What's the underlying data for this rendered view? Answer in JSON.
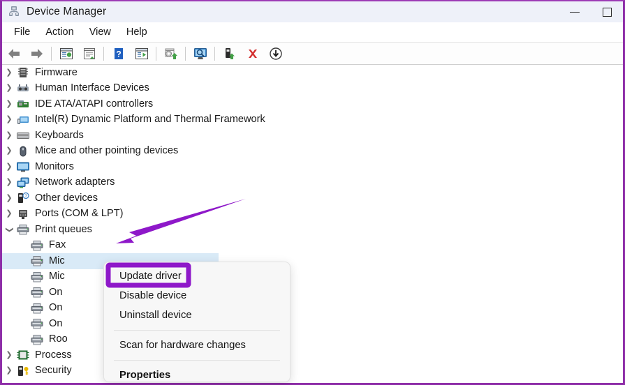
{
  "window": {
    "title": "Device Manager",
    "icon": "device-manager-icon",
    "accent_border": "#8e2ea8",
    "titlebar_bg": "#eef1f9",
    "controls": [
      {
        "name": "minimize",
        "glyph": "—"
      },
      {
        "name": "maximize",
        "glyph": "□"
      }
    ]
  },
  "menubar": {
    "items": [
      {
        "label": "File"
      },
      {
        "label": "Action"
      },
      {
        "label": "View"
      },
      {
        "label": "Help"
      }
    ]
  },
  "toolbar": {
    "buttons": [
      {
        "name": "back-icon"
      },
      {
        "name": "forward-icon"
      },
      {
        "name": "separator"
      },
      {
        "name": "properties-icon"
      },
      {
        "name": "print-icon"
      },
      {
        "name": "separator"
      },
      {
        "name": "help-icon"
      },
      {
        "name": "show-hidden-devices-icon"
      },
      {
        "name": "separator"
      },
      {
        "name": "update-driver-icon"
      },
      {
        "name": "separator"
      },
      {
        "name": "scan-for-hardware-changes-icon"
      },
      {
        "name": "separator"
      },
      {
        "name": "add-device-icon"
      },
      {
        "name": "uninstall-device-icon"
      },
      {
        "name": "disable-device-icon"
      }
    ]
  },
  "tree": {
    "selected_index": 12,
    "selection_color": "#d9eaf7",
    "items": [
      {
        "label": "Firmware",
        "indent": 0,
        "expander": "collapsed",
        "icon": "firmware-icon"
      },
      {
        "label": "Human Interface Devices",
        "indent": 0,
        "expander": "collapsed",
        "icon": "hid-icon"
      },
      {
        "label": "IDE ATA/ATAPI controllers",
        "indent": 0,
        "expander": "collapsed",
        "icon": "ide-controller-icon"
      },
      {
        "label": "Intel(R) Dynamic Platform and Thermal Framework",
        "indent": 0,
        "expander": "collapsed",
        "icon": "thermal-framework-icon"
      },
      {
        "label": "Keyboards",
        "indent": 0,
        "expander": "collapsed",
        "icon": "keyboard-icon"
      },
      {
        "label": "Mice and other pointing devices",
        "indent": 0,
        "expander": "collapsed",
        "icon": "mouse-icon"
      },
      {
        "label": "Monitors",
        "indent": 0,
        "expander": "collapsed",
        "icon": "monitor-icon"
      },
      {
        "label": "Network adapters",
        "indent": 0,
        "expander": "collapsed",
        "icon": "network-adapter-icon"
      },
      {
        "label": "Other devices",
        "indent": 0,
        "expander": "collapsed",
        "icon": "other-devices-icon"
      },
      {
        "label": "Ports (COM & LPT)",
        "indent": 0,
        "expander": "collapsed",
        "icon": "port-icon"
      },
      {
        "label": "Print queues",
        "indent": 0,
        "expander": "expanded",
        "icon": "printer-icon"
      },
      {
        "label": "Fax",
        "indent": 1,
        "expander": "none",
        "icon": "printer-icon"
      },
      {
        "label": "Mic",
        "indent": 1,
        "expander": "none",
        "icon": "printer-icon"
      },
      {
        "label": "Mic",
        "indent": 1,
        "expander": "none",
        "icon": "printer-icon"
      },
      {
        "label": "On",
        "indent": 1,
        "expander": "none",
        "icon": "printer-icon"
      },
      {
        "label": "On",
        "indent": 1,
        "expander": "none",
        "icon": "printer-icon"
      },
      {
        "label": "On",
        "indent": 1,
        "expander": "none",
        "icon": "printer-icon"
      },
      {
        "label": "Roo",
        "indent": 1,
        "expander": "none",
        "icon": "printer-icon"
      },
      {
        "label": "Process",
        "indent": 0,
        "expander": "collapsed",
        "icon": "processor-icon"
      },
      {
        "label": "Security",
        "indent": 0,
        "expander": "collapsed",
        "icon": "security-device-icon"
      }
    ]
  },
  "context_menu": {
    "highlight_color": "#8e18c9",
    "items": [
      {
        "label": "Update driver",
        "type": "item",
        "highlighted": true,
        "bold": false
      },
      {
        "label": "Disable device",
        "type": "item",
        "highlighted": false,
        "bold": false
      },
      {
        "label": "Uninstall device",
        "type": "item",
        "highlighted": false,
        "bold": false
      },
      {
        "label": "",
        "type": "separator",
        "highlighted": false,
        "bold": false
      },
      {
        "label": "Scan for hardware changes",
        "type": "item",
        "highlighted": false,
        "bold": false
      },
      {
        "label": "",
        "type": "separator",
        "highlighted": false,
        "bold": false
      },
      {
        "label": "Properties",
        "type": "item",
        "highlighted": false,
        "bold": true
      }
    ]
  },
  "annotation": {
    "arrow_color": "#8e18c9",
    "points_to": "Print queues"
  }
}
